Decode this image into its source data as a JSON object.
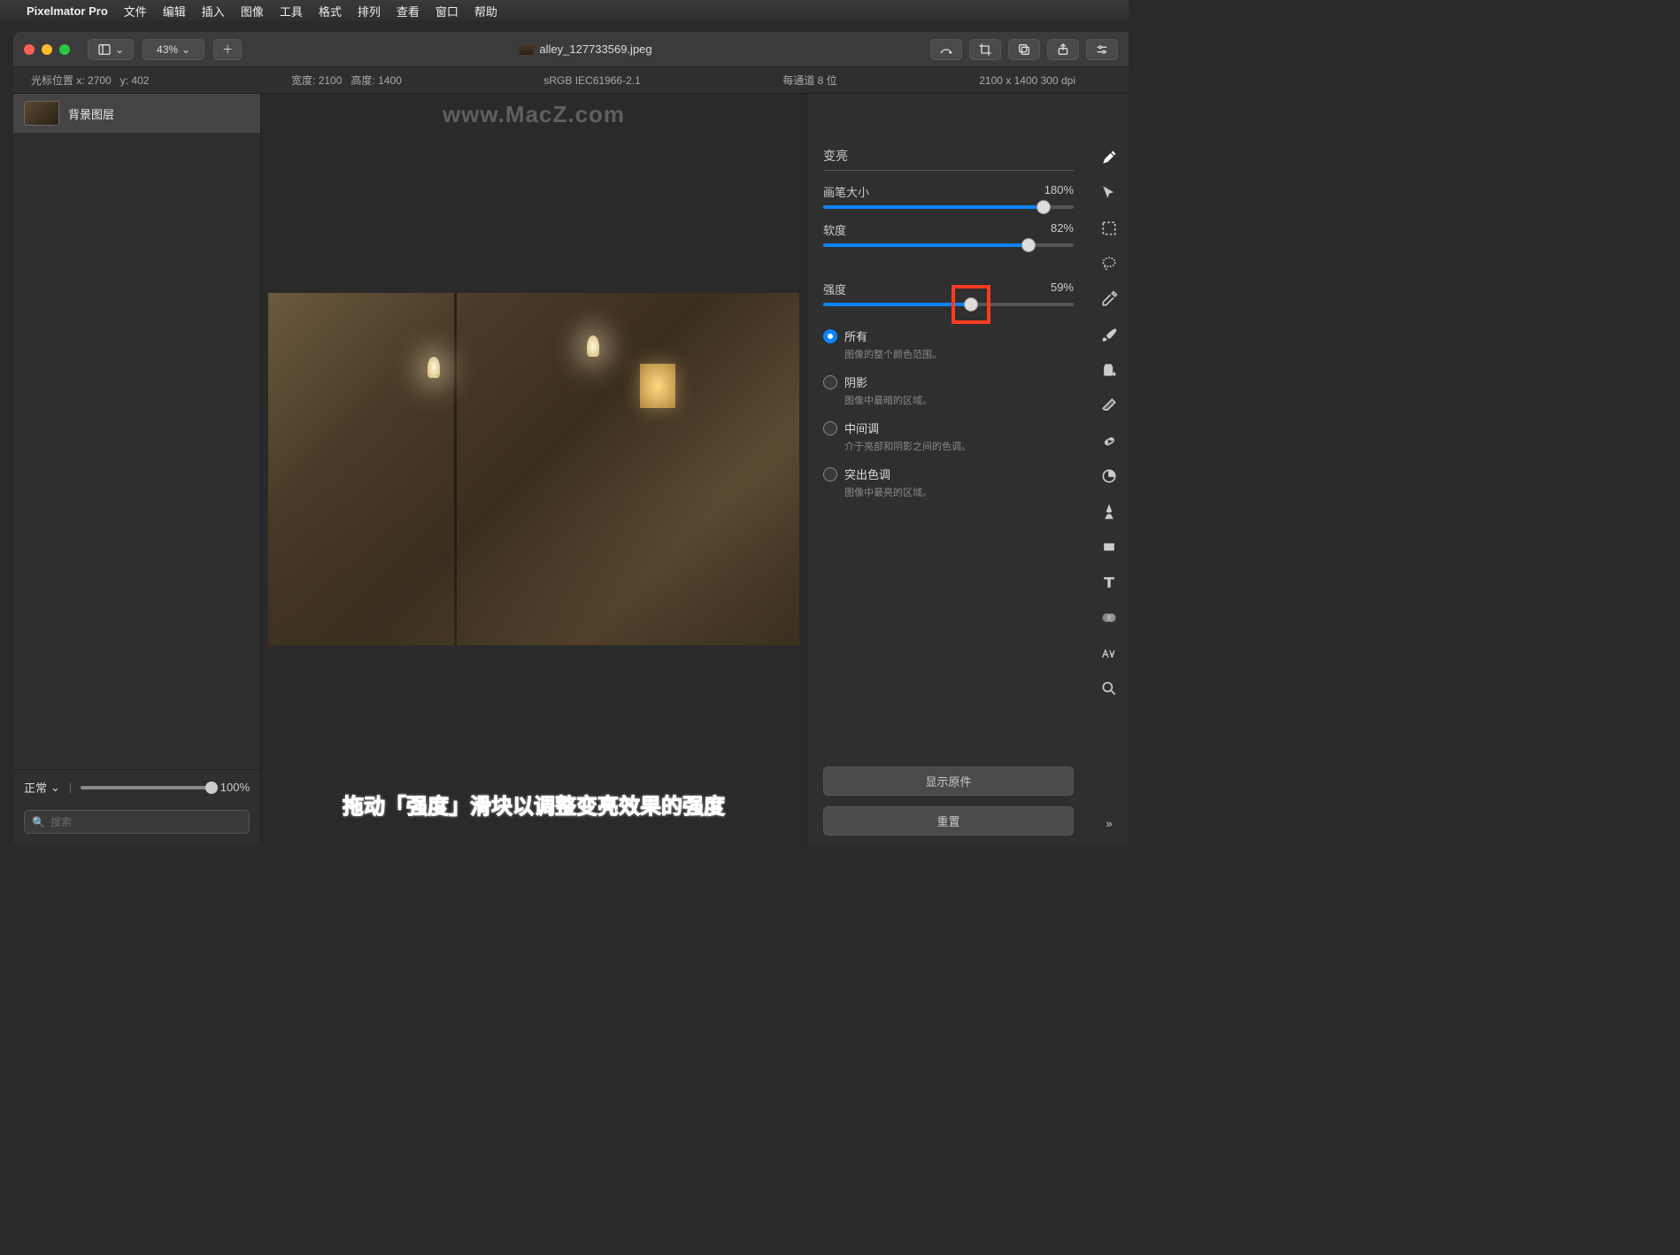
{
  "menubar": {
    "app": "Pixelmator Pro",
    "items": [
      "文件",
      "编辑",
      "插入",
      "图像",
      "工具",
      "格式",
      "排列",
      "查看",
      "窗口",
      "帮助"
    ]
  },
  "titlebar": {
    "zoom": "43%",
    "filename": "alley_127733569.jpeg"
  },
  "infobar": {
    "cursor_label": "光标位置 x:",
    "cursor_x": "2700",
    "cursor_y_label": "y:",
    "cursor_y": "402",
    "width_label": "宽度:",
    "width": "2100",
    "height_label": "高度:",
    "height": "1400",
    "colorspace": "sRGB IEC61966-2.1",
    "bitdepth": "每通道 8 位",
    "dims": "2100 x 1400 300 dpi"
  },
  "layers": {
    "bg": "背景图层",
    "blend": "正常",
    "opacity": "100%",
    "opacity_pct": 100,
    "search_placeholder": "搜索"
  },
  "panel": {
    "title": "变亮",
    "brush_label": "画笔大小",
    "brush_value": "180%",
    "brush_pct": 88,
    "soft_label": "软度",
    "soft_value": "82%",
    "soft_pct": 82,
    "strength_label": "强度",
    "strength_value": "59%",
    "strength_pct": 59,
    "radios": [
      {
        "label": "所有",
        "desc": "图像的整个颜色范围。",
        "on": true
      },
      {
        "label": "阴影",
        "desc": "图像中最暗的区域。",
        "on": false
      },
      {
        "label": "中间调",
        "desc": "介于亮部和阴影之间的色调。",
        "on": false
      },
      {
        "label": "突出色调",
        "desc": "图像中最亮的区域。",
        "on": false
      }
    ],
    "show_original": "显示原件",
    "reset": "重置"
  },
  "watermark": "www.MacZ.com",
  "instruction": "拖动「强度」滑块以调整变亮效果的强度"
}
